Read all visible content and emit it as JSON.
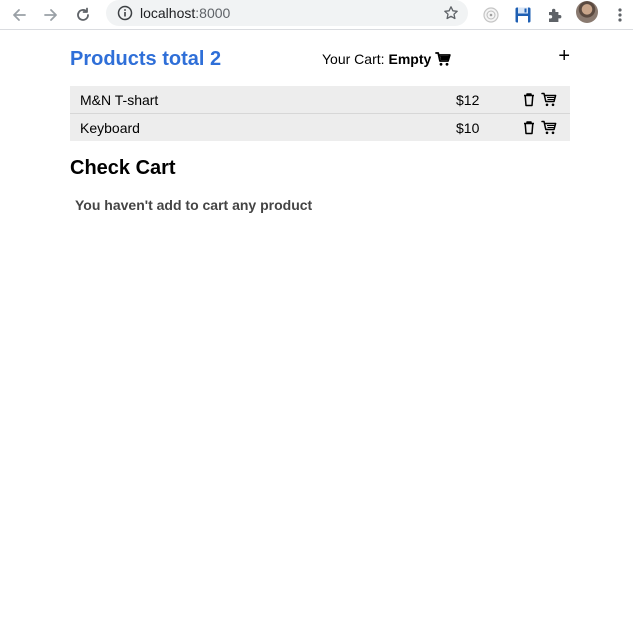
{
  "browser": {
    "url_host": "localhost",
    "url_port": ":8000"
  },
  "app": {
    "products_title": "Products total 2",
    "cart_label": "Your Cart:",
    "cart_status": "Empty",
    "add_label": "+",
    "products": [
      {
        "name": "M&N T-shart",
        "price": "$12"
      },
      {
        "name": "Keyboard",
        "price": "$10"
      }
    ],
    "check_cart_title": "Check Cart",
    "empty_cart_message": "You haven't add to cart any product"
  },
  "icons": {
    "back": "arrow-left-icon",
    "forward": "arrow-right-icon",
    "reload": "reload-icon",
    "info": "info-icon",
    "star": "star-icon",
    "extension1": "timer-extension-icon",
    "extension2": "save-extension-icon",
    "extensions": "puzzle-icon",
    "menu": "kebab-menu-icon",
    "cart": "cart-icon",
    "trash": "trash-icon"
  },
  "colors": {
    "accent_blue": "#2f6fd8",
    "row_bg": "#ededed",
    "toolbar_bg": "#ffffff",
    "omnibox_bg": "#f1f3f4"
  }
}
